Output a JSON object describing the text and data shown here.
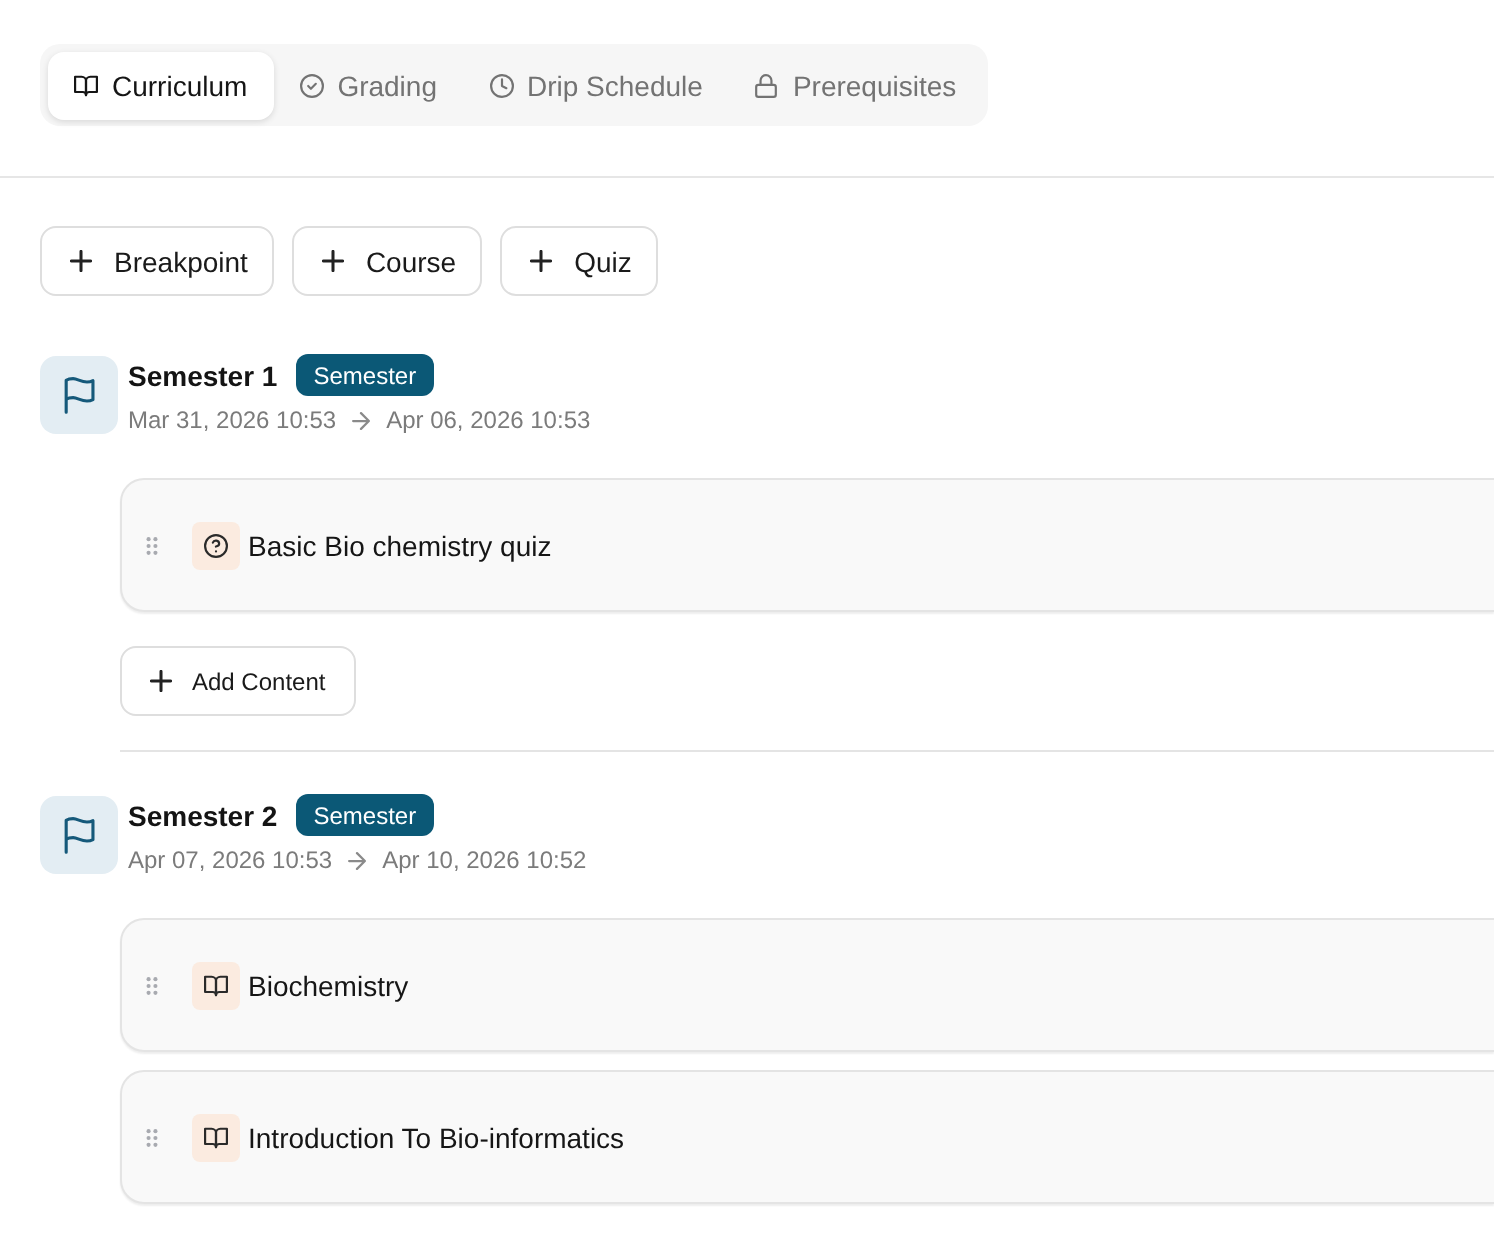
{
  "tabs": [
    {
      "label": "Curriculum",
      "selected": true
    },
    {
      "label": "Grading",
      "selected": false
    },
    {
      "label": "Drip Schedule",
      "selected": false
    },
    {
      "label": "Prerequisites",
      "selected": false
    }
  ],
  "add_buttons": [
    "Breakpoint",
    "Course",
    "Quiz"
  ],
  "sections": [
    {
      "title": "Semester 1",
      "badge": "Semester",
      "start": "Mar 31, 2026 10:53",
      "end": "Apr 06, 2026 10:53",
      "items": [
        {
          "kind": "quiz",
          "title": "Basic Bio chemistry quiz"
        }
      ],
      "add_button": "Add Content"
    },
    {
      "title": "Semester 2",
      "badge": "Semester",
      "start": "Apr 07, 2026 10:53",
      "end": "Apr 10, 2026 10:52",
      "items": [
        {
          "kind": "course",
          "title": "Biochemistry"
        },
        {
          "kind": "course",
          "title": "Introduction To Bio-informatics"
        }
      ]
    }
  ]
}
